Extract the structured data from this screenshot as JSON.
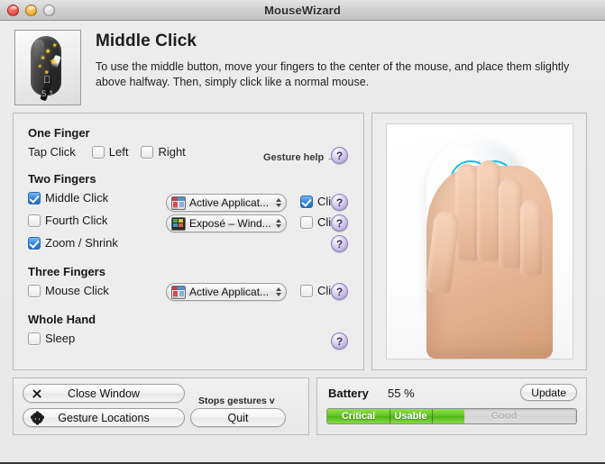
{
  "window": {
    "title": "MouseWizard",
    "traffic_lights": [
      "close-button",
      "minimize-button",
      "zoom-button"
    ]
  },
  "header": {
    "icon_name": "mousewizard-app-icon",
    "icon_version": "5.1",
    "title": "Middle Click",
    "description": "To use the middle button, move your fingers to the center of the mouse, and place them slightly above halfway. Then, simply click like a normal mouse."
  },
  "gestures": {
    "gesture_help_label": "Gesture help →",
    "groups": [
      {
        "title": "One Finger",
        "rows": [
          {
            "label": "Tap Click",
            "checkboxes": [
              {
                "label": "Left",
                "checked": false
              },
              {
                "label": "Right",
                "checked": false
              }
            ]
          }
        ]
      },
      {
        "title": "Two Fingers",
        "rows": [
          {
            "label": "Middle Click",
            "checked": true,
            "popup": {
              "value": "Active Applicat...",
              "icon": "active-application-icon"
            },
            "click": {
              "label": "Click",
              "checked": true
            },
            "help": "?"
          },
          {
            "label": "Fourth Click",
            "checked": false,
            "popup": {
              "value": "Exposé – Wind...",
              "icon": "expose-icon"
            },
            "click": {
              "label": "Click",
              "checked": false
            },
            "help": "?"
          },
          {
            "label": "Zoom / Shrink",
            "checked": true,
            "help": "?"
          }
        ]
      },
      {
        "title": "Three Fingers",
        "rows": [
          {
            "label": "Mouse Click",
            "checked": false,
            "popup": {
              "value": "Active Applicat...",
              "icon": "active-application-icon"
            },
            "click": {
              "label": "Click",
              "checked": false
            },
            "help": "?"
          }
        ]
      },
      {
        "title": "Whole Hand",
        "rows": [
          {
            "label": "Sleep",
            "checked": false,
            "help": "?"
          }
        ]
      }
    ]
  },
  "preview": {
    "name": "hand-on-magic-mouse-illustration",
    "highlight_color": "#12bff0",
    "finger_count": 2
  },
  "actions": {
    "close_window": "Close Window",
    "gesture_locations": "Gesture Locations",
    "quit": "Quit",
    "quit_note": "Stops gestures v"
  },
  "battery": {
    "title": "Battery",
    "percent_label": "55 %",
    "percent_value": 55,
    "update_label": "Update",
    "segments": [
      {
        "label": "Critical",
        "start": 0,
        "end": 25
      },
      {
        "label": "Usable",
        "start": 25,
        "end": 42
      },
      {
        "label": "Good",
        "start": 42,
        "end": 100
      }
    ],
    "fill_color": "#5fc41c"
  }
}
